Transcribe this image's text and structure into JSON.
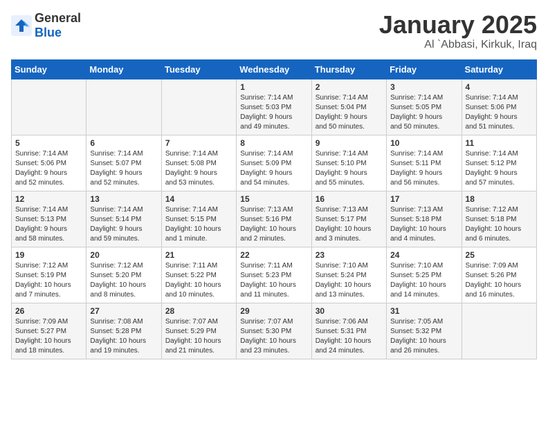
{
  "header": {
    "logo_general": "General",
    "logo_blue": "Blue",
    "title": "January 2025",
    "subtitle": "Al `Abbasi, Kirkuk, Iraq"
  },
  "weekdays": [
    "Sunday",
    "Monday",
    "Tuesday",
    "Wednesday",
    "Thursday",
    "Friday",
    "Saturday"
  ],
  "weeks": [
    [
      {
        "day": "",
        "text": ""
      },
      {
        "day": "",
        "text": ""
      },
      {
        "day": "",
        "text": ""
      },
      {
        "day": "1",
        "text": "Sunrise: 7:14 AM\nSunset: 5:03 PM\nDaylight: 9 hours\nand 49 minutes."
      },
      {
        "day": "2",
        "text": "Sunrise: 7:14 AM\nSunset: 5:04 PM\nDaylight: 9 hours\nand 50 minutes."
      },
      {
        "day": "3",
        "text": "Sunrise: 7:14 AM\nSunset: 5:05 PM\nDaylight: 9 hours\nand 50 minutes."
      },
      {
        "day": "4",
        "text": "Sunrise: 7:14 AM\nSunset: 5:06 PM\nDaylight: 9 hours\nand 51 minutes."
      }
    ],
    [
      {
        "day": "5",
        "text": "Sunrise: 7:14 AM\nSunset: 5:06 PM\nDaylight: 9 hours\nand 52 minutes."
      },
      {
        "day": "6",
        "text": "Sunrise: 7:14 AM\nSunset: 5:07 PM\nDaylight: 9 hours\nand 52 minutes."
      },
      {
        "day": "7",
        "text": "Sunrise: 7:14 AM\nSunset: 5:08 PM\nDaylight: 9 hours\nand 53 minutes."
      },
      {
        "day": "8",
        "text": "Sunrise: 7:14 AM\nSunset: 5:09 PM\nDaylight: 9 hours\nand 54 minutes."
      },
      {
        "day": "9",
        "text": "Sunrise: 7:14 AM\nSunset: 5:10 PM\nDaylight: 9 hours\nand 55 minutes."
      },
      {
        "day": "10",
        "text": "Sunrise: 7:14 AM\nSunset: 5:11 PM\nDaylight: 9 hours\nand 56 minutes."
      },
      {
        "day": "11",
        "text": "Sunrise: 7:14 AM\nSunset: 5:12 PM\nDaylight: 9 hours\nand 57 minutes."
      }
    ],
    [
      {
        "day": "12",
        "text": "Sunrise: 7:14 AM\nSunset: 5:13 PM\nDaylight: 9 hours\nand 58 minutes."
      },
      {
        "day": "13",
        "text": "Sunrise: 7:14 AM\nSunset: 5:14 PM\nDaylight: 9 hours\nand 59 minutes."
      },
      {
        "day": "14",
        "text": "Sunrise: 7:14 AM\nSunset: 5:15 PM\nDaylight: 10 hours\nand 1 minute."
      },
      {
        "day": "15",
        "text": "Sunrise: 7:13 AM\nSunset: 5:16 PM\nDaylight: 10 hours\nand 2 minutes."
      },
      {
        "day": "16",
        "text": "Sunrise: 7:13 AM\nSunset: 5:17 PM\nDaylight: 10 hours\nand 3 minutes."
      },
      {
        "day": "17",
        "text": "Sunrise: 7:13 AM\nSunset: 5:18 PM\nDaylight: 10 hours\nand 4 minutes."
      },
      {
        "day": "18",
        "text": "Sunrise: 7:12 AM\nSunset: 5:18 PM\nDaylight: 10 hours\nand 6 minutes."
      }
    ],
    [
      {
        "day": "19",
        "text": "Sunrise: 7:12 AM\nSunset: 5:19 PM\nDaylight: 10 hours\nand 7 minutes."
      },
      {
        "day": "20",
        "text": "Sunrise: 7:12 AM\nSunset: 5:20 PM\nDaylight: 10 hours\nand 8 minutes."
      },
      {
        "day": "21",
        "text": "Sunrise: 7:11 AM\nSunset: 5:22 PM\nDaylight: 10 hours\nand 10 minutes."
      },
      {
        "day": "22",
        "text": "Sunrise: 7:11 AM\nSunset: 5:23 PM\nDaylight: 10 hours\nand 11 minutes."
      },
      {
        "day": "23",
        "text": "Sunrise: 7:10 AM\nSunset: 5:24 PM\nDaylight: 10 hours\nand 13 minutes."
      },
      {
        "day": "24",
        "text": "Sunrise: 7:10 AM\nSunset: 5:25 PM\nDaylight: 10 hours\nand 14 minutes."
      },
      {
        "day": "25",
        "text": "Sunrise: 7:09 AM\nSunset: 5:26 PM\nDaylight: 10 hours\nand 16 minutes."
      }
    ],
    [
      {
        "day": "26",
        "text": "Sunrise: 7:09 AM\nSunset: 5:27 PM\nDaylight: 10 hours\nand 18 minutes."
      },
      {
        "day": "27",
        "text": "Sunrise: 7:08 AM\nSunset: 5:28 PM\nDaylight: 10 hours\nand 19 minutes."
      },
      {
        "day": "28",
        "text": "Sunrise: 7:07 AM\nSunset: 5:29 PM\nDaylight: 10 hours\nand 21 minutes."
      },
      {
        "day": "29",
        "text": "Sunrise: 7:07 AM\nSunset: 5:30 PM\nDaylight: 10 hours\nand 23 minutes."
      },
      {
        "day": "30",
        "text": "Sunrise: 7:06 AM\nSunset: 5:31 PM\nDaylight: 10 hours\nand 24 minutes."
      },
      {
        "day": "31",
        "text": "Sunrise: 7:05 AM\nSunset: 5:32 PM\nDaylight: 10 hours\nand 26 minutes."
      },
      {
        "day": "",
        "text": ""
      }
    ]
  ]
}
